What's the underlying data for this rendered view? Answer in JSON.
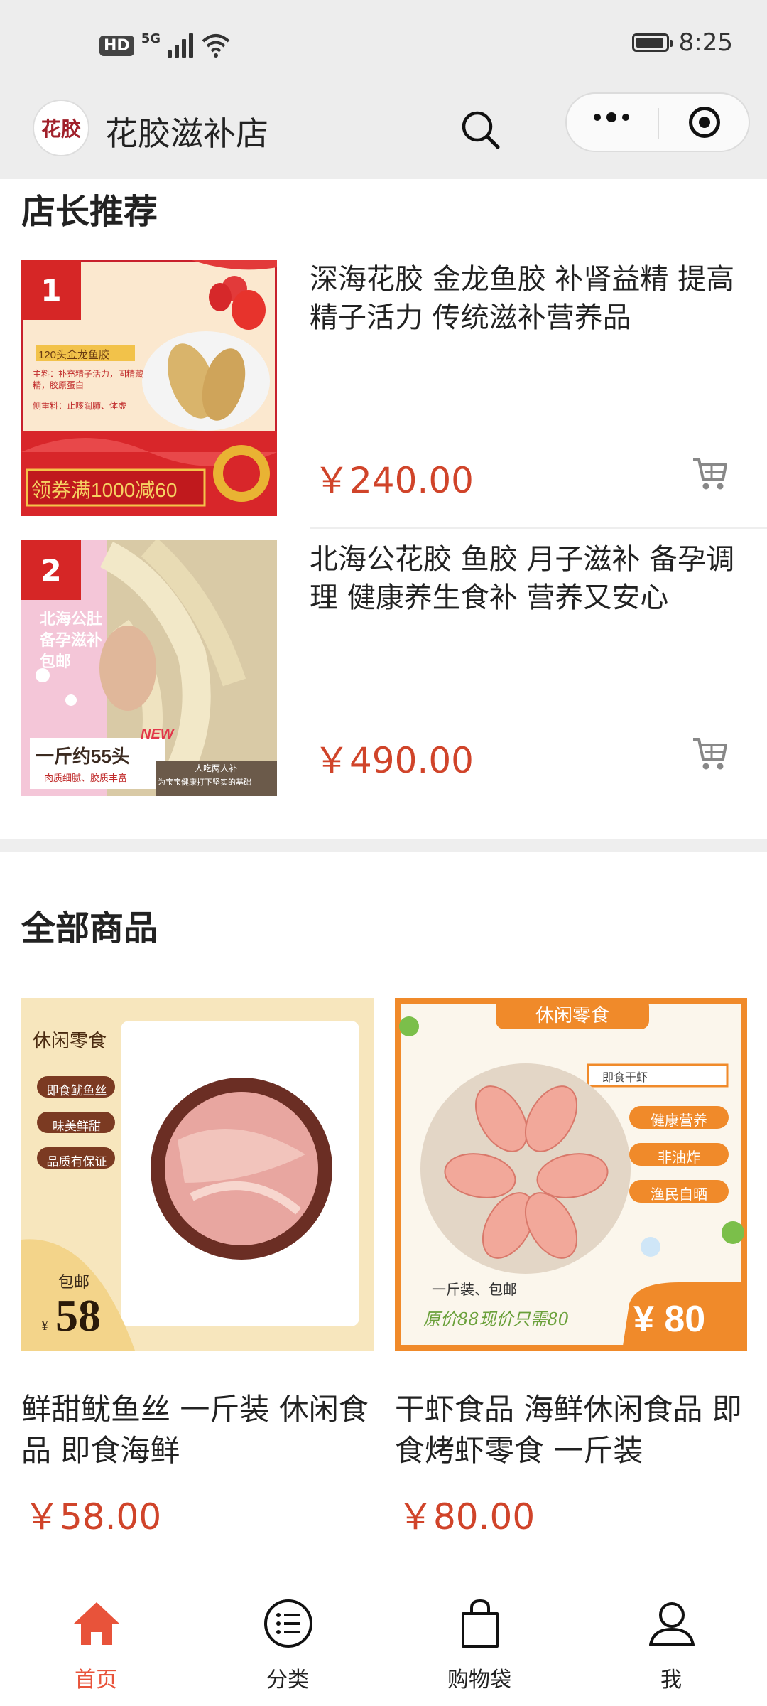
{
  "status_bar": {
    "network": "5G",
    "hd": "HD",
    "time": "8:25"
  },
  "header": {
    "logo_text": "花胶",
    "title": "花胶滋补店"
  },
  "recommend": {
    "title": "店长推荐",
    "items": [
      {
        "rank": "1",
        "name": "深海花胶 金龙鱼胶 补肾益精 提高精子活力 传统滋补营养品",
        "price": "￥240.00",
        "image": {
          "tag": "120头金龙鱼胶",
          "line1": "主料：补充精子活力，固精藏精，胶原蛋白",
          "line2": "侧重料：止咳润肺、体虚",
          "coupon": "领券满1000减60"
        }
      },
      {
        "rank": "2",
        "name": "北海公花胶 鱼胶 月子滋补 备孕调理 健康养生食补 营养又安心",
        "price": "￥490.00",
        "image": {
          "headline": "北海公肚 备孕滋补 包邮",
          "new": "NEW",
          "weight": "一斤约55头",
          "sub": "肉质细腻、胶质丰富",
          "right1": "一人吃两人补",
          "right2": "为宝宝健康打下坚实的基础"
        }
      }
    ]
  },
  "all_products": {
    "title": "全部商品",
    "items": [
      {
        "name": "鲜甜鱿鱼丝 一斤装 休闲食品 即食海鲜",
        "price": "￥58.00",
        "image": {
          "vertical": "休闲零食",
          "tags": [
            "即食鱿鱼丝",
            "味美鲜甜",
            "品质有保证"
          ],
          "badge_label": "包邮",
          "badge_currency": "¥",
          "badge_price": "58"
        }
      },
      {
        "name": "干虾食品 海鲜休闲食品 即食烤虾零食 一斤装",
        "price": "￥80.00",
        "image": {
          "banner": "休闲零食",
          "search": "即食干虾",
          "tags": [
            "健康营养",
            "非油炸",
            "渔民自晒"
          ],
          "line1": "一斤装、包邮",
          "line2": "原价88现价只需80",
          "badge": "¥ 80"
        }
      }
    ]
  },
  "tabbar": {
    "tabs": [
      {
        "label": "首页",
        "icon": "home-icon"
      },
      {
        "label": "分类",
        "icon": "list-icon"
      },
      {
        "label": "购物袋",
        "icon": "bag-icon"
      },
      {
        "label": "我",
        "icon": "user-icon"
      }
    ]
  },
  "colors": {
    "accent": "#e8533a",
    "price": "#d0442a",
    "rank_badge": "#d62626"
  }
}
